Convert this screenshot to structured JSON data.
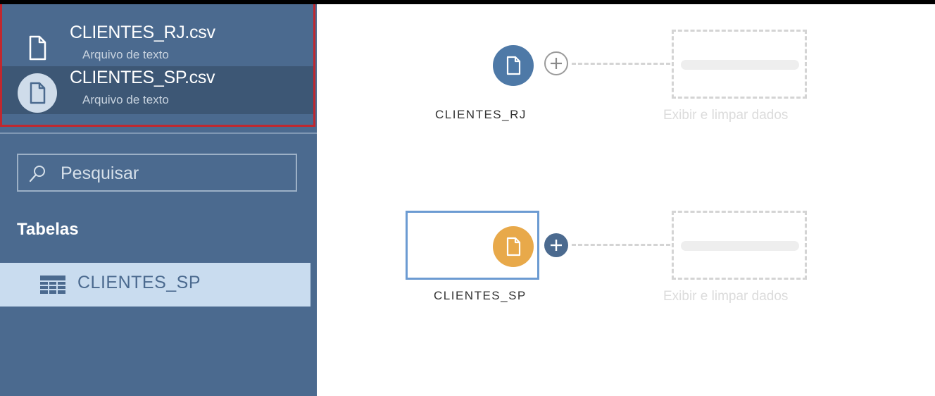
{
  "connections": [
    {
      "name": "CLIENTES_RJ.csv",
      "subtitle": "Arquivo de texto",
      "icon": "file-icon",
      "selected": false
    },
    {
      "name": "CLIENTES_SP.csv",
      "subtitle": "Arquivo de texto",
      "icon": "file-icon",
      "selected": true
    }
  ],
  "search": {
    "placeholder": "Pesquisar",
    "value": ""
  },
  "tables_section": {
    "title": "Tabelas",
    "items": [
      {
        "label": "CLIENTES_SP",
        "icon": "table-grid-icon"
      }
    ]
  },
  "flow": {
    "nodes": [
      {
        "label": "CLIENTES_RJ",
        "color": "#4e79a7",
        "selected": false,
        "next_step_label": "Exibir e limpar dados"
      },
      {
        "label": "CLIENTES_SP",
        "color": "#e8a94a",
        "selected": true,
        "next_step_label": "Exibir e limpar dados"
      }
    ]
  },
  "colors": {
    "sidebar_bg": "#4b6a8f",
    "selection_border": "#c0282f",
    "node_blue": "#4e79a7",
    "node_orange": "#e8a94a",
    "table_item_bg": "#c9dcef"
  }
}
